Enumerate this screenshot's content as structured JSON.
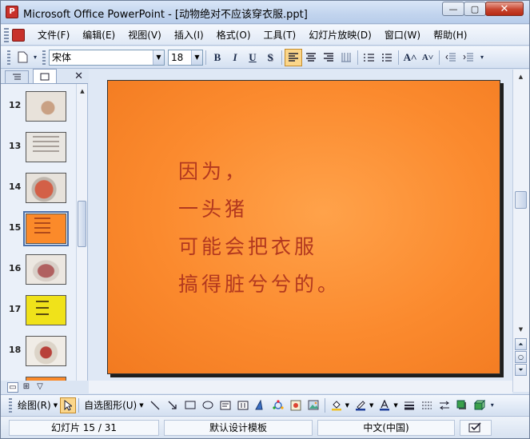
{
  "window": {
    "title": "Microsoft Office PowerPoint - [动物绝对不应该穿衣服.ppt]",
    "app_icon_glyph": "P",
    "min_glyph": "—",
    "max_glyph": "▢",
    "close_glyph": "✕"
  },
  "menu": {
    "items": [
      "文件(F)",
      "编辑(E)",
      "视图(V)",
      "插入(I)",
      "格式(O)",
      "工具(T)",
      "幻灯片放映(D)",
      "窗口(W)",
      "帮助(H)"
    ]
  },
  "toolbar": {
    "font_name": "宋体",
    "font_size": "18",
    "bold": "B",
    "italic": "I",
    "underline": "U",
    "shadow": "S",
    "grow_font": "A˄",
    "shrink_font": "A˅"
  },
  "left_pane": {
    "close_glyph": "✕",
    "slides": [
      {
        "num": "12"
      },
      {
        "num": "13"
      },
      {
        "num": "14"
      },
      {
        "num": "15"
      },
      {
        "num": "16"
      },
      {
        "num": "17"
      },
      {
        "num": "18"
      }
    ],
    "selected_index": 3
  },
  "slide": {
    "lines": [
      "因为，",
      "一头猪",
      "可能会把衣服",
      "搞得脏兮兮的。"
    ],
    "background_color": "#fb8a2e",
    "text_color": "#b2381f"
  },
  "drawbar": {
    "draw_label": "绘图(R)",
    "autoshapes_label": "自选图形(U)"
  },
  "status": {
    "slide_info": "幻灯片 15 / 31",
    "design": "默认设计模板",
    "language": "中文(中国)"
  }
}
